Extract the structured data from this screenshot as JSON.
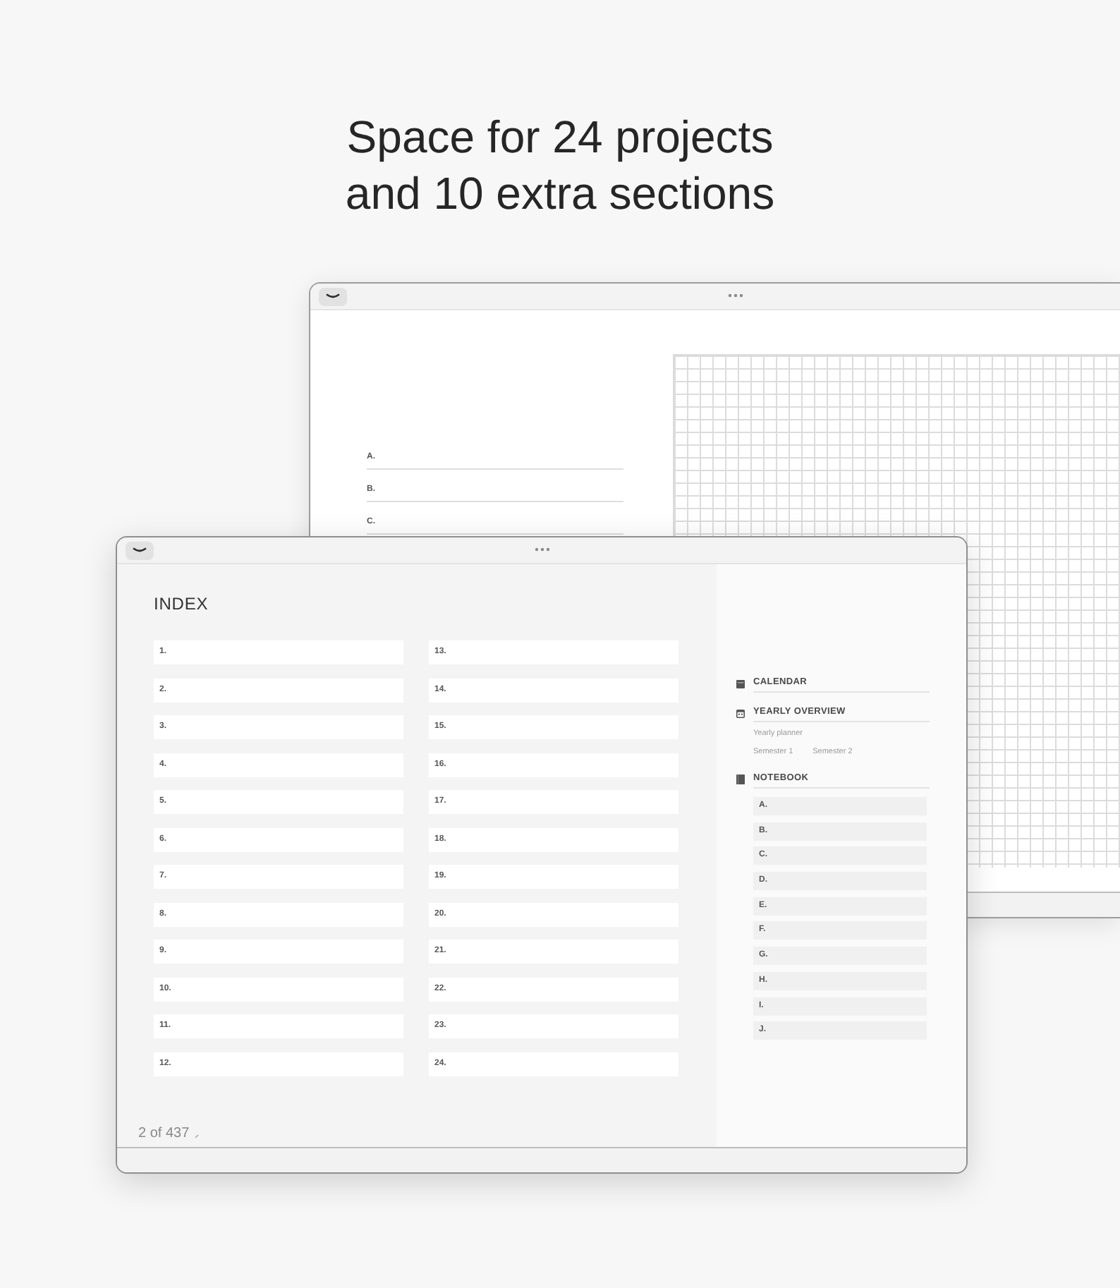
{
  "headline": {
    "lines": [
      "Space for 24 projects",
      "and 10 extra sections"
    ]
  },
  "back_window": {
    "notebook_lines": [
      "A.",
      "B.",
      "C."
    ]
  },
  "front_window": {
    "index": {
      "title": "INDEX",
      "entries": [
        "1.",
        "2.",
        "3.",
        "4.",
        "5.",
        "6.",
        "7.",
        "8.",
        "9.",
        "10.",
        "11.",
        "12.",
        "13.",
        "14.",
        "15.",
        "16.",
        "17.",
        "18.",
        "19.",
        "20.",
        "21.",
        "22.",
        "23.",
        "24."
      ]
    },
    "page_indicator": "2 of 437",
    "sidebar": {
      "calendar": {
        "title": "CALENDAR"
      },
      "yearly_overview": {
        "title": "YEARLY OVERVIEW",
        "planner": "Yearly planner",
        "semesters": [
          "Semester 1",
          "Semester 2"
        ]
      },
      "notebook": {
        "title": "NOTEBOOK",
        "sections": [
          "A.",
          "B.",
          "C.",
          "D.",
          "E.",
          "F.",
          "G.",
          "H.",
          "I.",
          "J."
        ]
      }
    }
  }
}
